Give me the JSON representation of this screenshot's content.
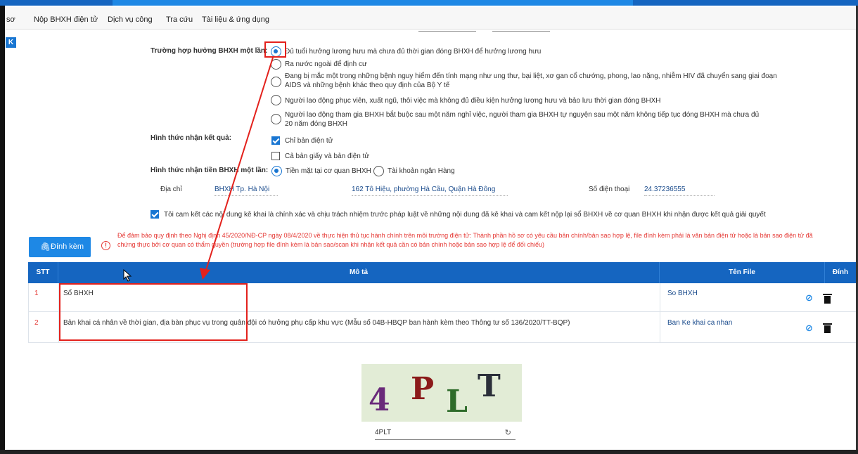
{
  "menu": {
    "partial_item": "sơ",
    "items": [
      "Nộp BHXH điện tử",
      "Dịch vụ công",
      "Tra cứu",
      "Tài liệu & ứng dụng"
    ]
  },
  "form": {
    "case_label": "Trường hợp hưởng BHXH một lần:",
    "case_options": [
      {
        "line1": "Đủ tuổi hưởng lương hưu mà chưa đủ thời gian đóng BHXH để hưởng lương hưu",
        "line2": "",
        "selected": true
      },
      {
        "line1": "Ra nước ngoài để định cư",
        "line2": "",
        "selected": false
      },
      {
        "line1": "Đang bị mắc một trong những bệnh nguy hiểm đến tính mạng như ung thư, bại liệt, xơ gan cổ chướng, phong, lao nặng, nhiễm HIV đã chuyển sang giai đoạn",
        "line2": "AIDS và những bệnh khác theo quy định của Bộ Y tế",
        "selected": false
      },
      {
        "line1": "Người lao động phục viên, xuất ngũ, thôi việc mà không đủ điều kiện hưởng lương hưu và bảo lưu thời gian đóng BHXH",
        "line2": "",
        "selected": false
      },
      {
        "line1": "Người lao động tham gia BHXH bắt buộc sau một năm nghỉ việc, người tham gia BHXH tự nguyện sau một năm không tiếp tục đóng BHXH mà chưa đủ",
        "line2": "20 năm đóng BHXH",
        "selected": false
      }
    ],
    "result_label": "Hình thức nhận kết quả:",
    "result_options": [
      {
        "label": "Chỉ bản điện tử",
        "checked": true
      },
      {
        "label": "Cả bản giấy và bản điện tử",
        "checked": false
      }
    ],
    "money_label": "Hình thức nhận tiền BHXH một lần:",
    "money_options": [
      {
        "label": "Tiền mặt tại cơ quan BHXH",
        "selected": true
      },
      {
        "label": "Tài khoản ngân Hàng",
        "selected": false
      }
    ],
    "address_label": "Địa chỉ",
    "address_agency": "BHXH Tp. Hà Nội",
    "address_street": "162 Tô Hiệu, phường Hà Cầu, Quận Hà Đông",
    "phone_label": "Số điện thoại",
    "phone_value": "24.37236555",
    "commit_text": "Tôi cam kết các nội dung kê khai là chính xác và chịu trách nhiệm trước pháp luật về những nội dung đã kê khai và cam kết nộp lại sổ BHXH về cơ quan BHXH khi nhận được kết quả giải quyết",
    "commit_checked": true
  },
  "warning": {
    "line1": "Để đảm bảo quy định theo Nghị định 45/2020/NĐ-CP ngày 08/4/2020 về thực hiện thủ tục hành chính trên môi trường điện tử: Thành phần hồ sơ có yêu cầu bản chính/bản sao hợp lệ, file đính kèm phải là văn bản điện tử hoặc là bản sao điện tử đã",
    "line2": "chứng thực bởi cơ quan có thẩm quyền (trường hợp file đính kèm là bản sao/scan khi nhận kết quả cần có bản chính hoặc bản sao hợp lệ để đối chiếu)"
  },
  "attach_button": "Đính kèm",
  "table": {
    "headers": [
      "STT",
      "Mô tả",
      "Tên File",
      "Đính kèm"
    ],
    "rows": [
      {
        "stt": "1",
        "desc": "Sổ BHXH",
        "file": "So BHXH"
      },
      {
        "stt": "2",
        "desc": "Bản khai cá nhân về thời gian, địa bàn phục vụ trong quân đội có hưởng phụ cấp khu vực (Mẫu số 04B-HBQP ban hành kèm theo Thông tư số 136/2020/TT-BQP)",
        "file": "Ban Ke khai ca nhan"
      }
    ]
  },
  "captcha": {
    "chars": [
      "4",
      "P",
      "L",
      "T"
    ],
    "input_value": "4PLT"
  },
  "colors": {
    "primary": "#1e88e5",
    "header": "#1565c0",
    "warning": "#e53935",
    "annotation": "#e3211c"
  }
}
